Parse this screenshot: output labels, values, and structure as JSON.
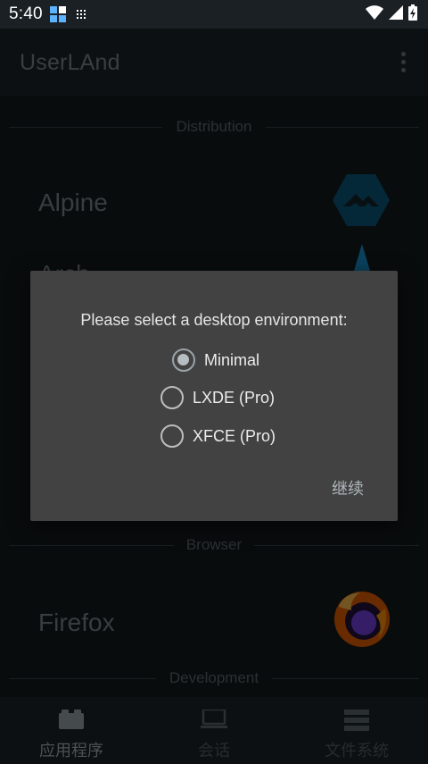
{
  "status_bar": {
    "time": "5:40",
    "icons": [
      "notification-icon",
      "grid-icon",
      "wifi-icon",
      "signal-icon",
      "battery-charging-icon"
    ]
  },
  "app_bar": {
    "title": "UserLAnd",
    "menu_icon": "overflow-menu-icon"
  },
  "sections": {
    "distribution": {
      "label": "Distribution"
    },
    "browser": {
      "label": "Browser"
    },
    "development": {
      "label": "Development"
    }
  },
  "apps": {
    "alpine": {
      "name": "Alpine",
      "logo": "alpine-logo"
    },
    "arch": {
      "name": "Arch",
      "logo": "arch-logo"
    },
    "firefox": {
      "name": "Firefox",
      "logo": "firefox-logo"
    }
  },
  "bottom_nav": {
    "tabs": [
      {
        "label": "应用程序",
        "icon": "apps-icon",
        "active": true
      },
      {
        "label": "会话",
        "icon": "laptop-icon",
        "active": false
      },
      {
        "label": "文件系统",
        "icon": "storage-icon",
        "active": false
      }
    ]
  },
  "dialog": {
    "prompt": "Please select a desktop environment:",
    "options": [
      {
        "label": "Minimal",
        "selected": true
      },
      {
        "label": "LXDE (Pro)",
        "selected": false
      },
      {
        "label": "XFCE (Pro)",
        "selected": false
      }
    ],
    "continue_label": "继续"
  },
  "colors": {
    "app_bar": "#1d2428",
    "content_bg": "#151b1e",
    "dialog_bg": "#424242",
    "alpine_blue": "#0d597f",
    "arch_blue": "#1793d1"
  }
}
